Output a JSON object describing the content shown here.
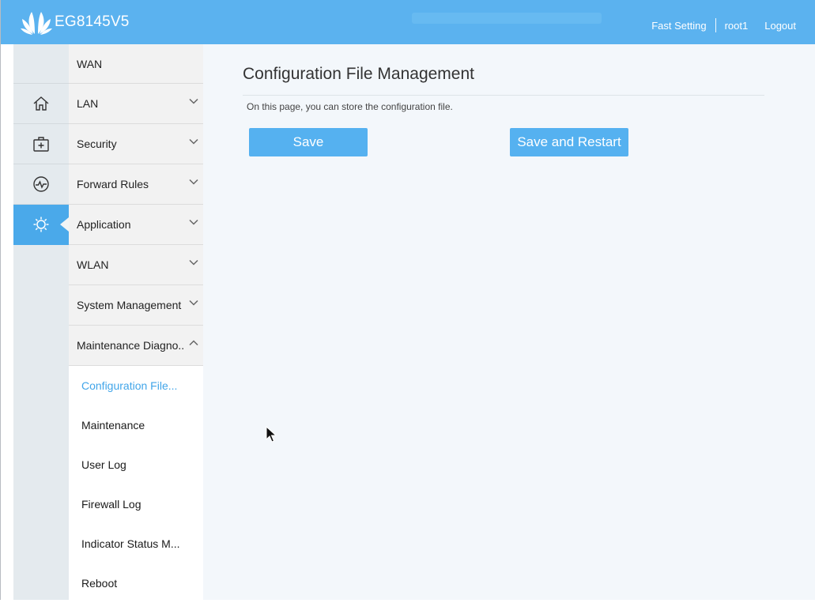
{
  "header": {
    "brand": "EG8145V5",
    "links": [
      "Fast Setting",
      "root1",
      "Logout"
    ]
  },
  "iconbar": {
    "icons": [
      "home-icon",
      "medical-kit-icon",
      "pulse-icon",
      "gear-icon"
    ],
    "active": "gear-icon"
  },
  "menu": {
    "items": [
      {
        "label": "WAN"
      },
      {
        "label": "LAN"
      },
      {
        "label": "Security"
      },
      {
        "label": "Forward Rules"
      },
      {
        "label": "Application"
      },
      {
        "label": "WLAN"
      },
      {
        "label": "System Management"
      },
      {
        "label": "Maintenance Diagno.."
      }
    ],
    "subitems": [
      {
        "label": "Configuration File..."
      },
      {
        "label": "Maintenance"
      },
      {
        "label": "User Log"
      },
      {
        "label": "Firewall Log"
      },
      {
        "label": "Indicator Status M..."
      },
      {
        "label": "Reboot"
      }
    ]
  },
  "main": {
    "title": "Configuration File Management",
    "description": "On this page, you can store the configuration file.",
    "save_label": "Save",
    "save_restart_label": "Save and Restart"
  },
  "colors": {
    "header": "#5bb2ef",
    "accent": "#4aa9ea",
    "button": "#55b1f0",
    "selected_text": "#41a5e9"
  }
}
